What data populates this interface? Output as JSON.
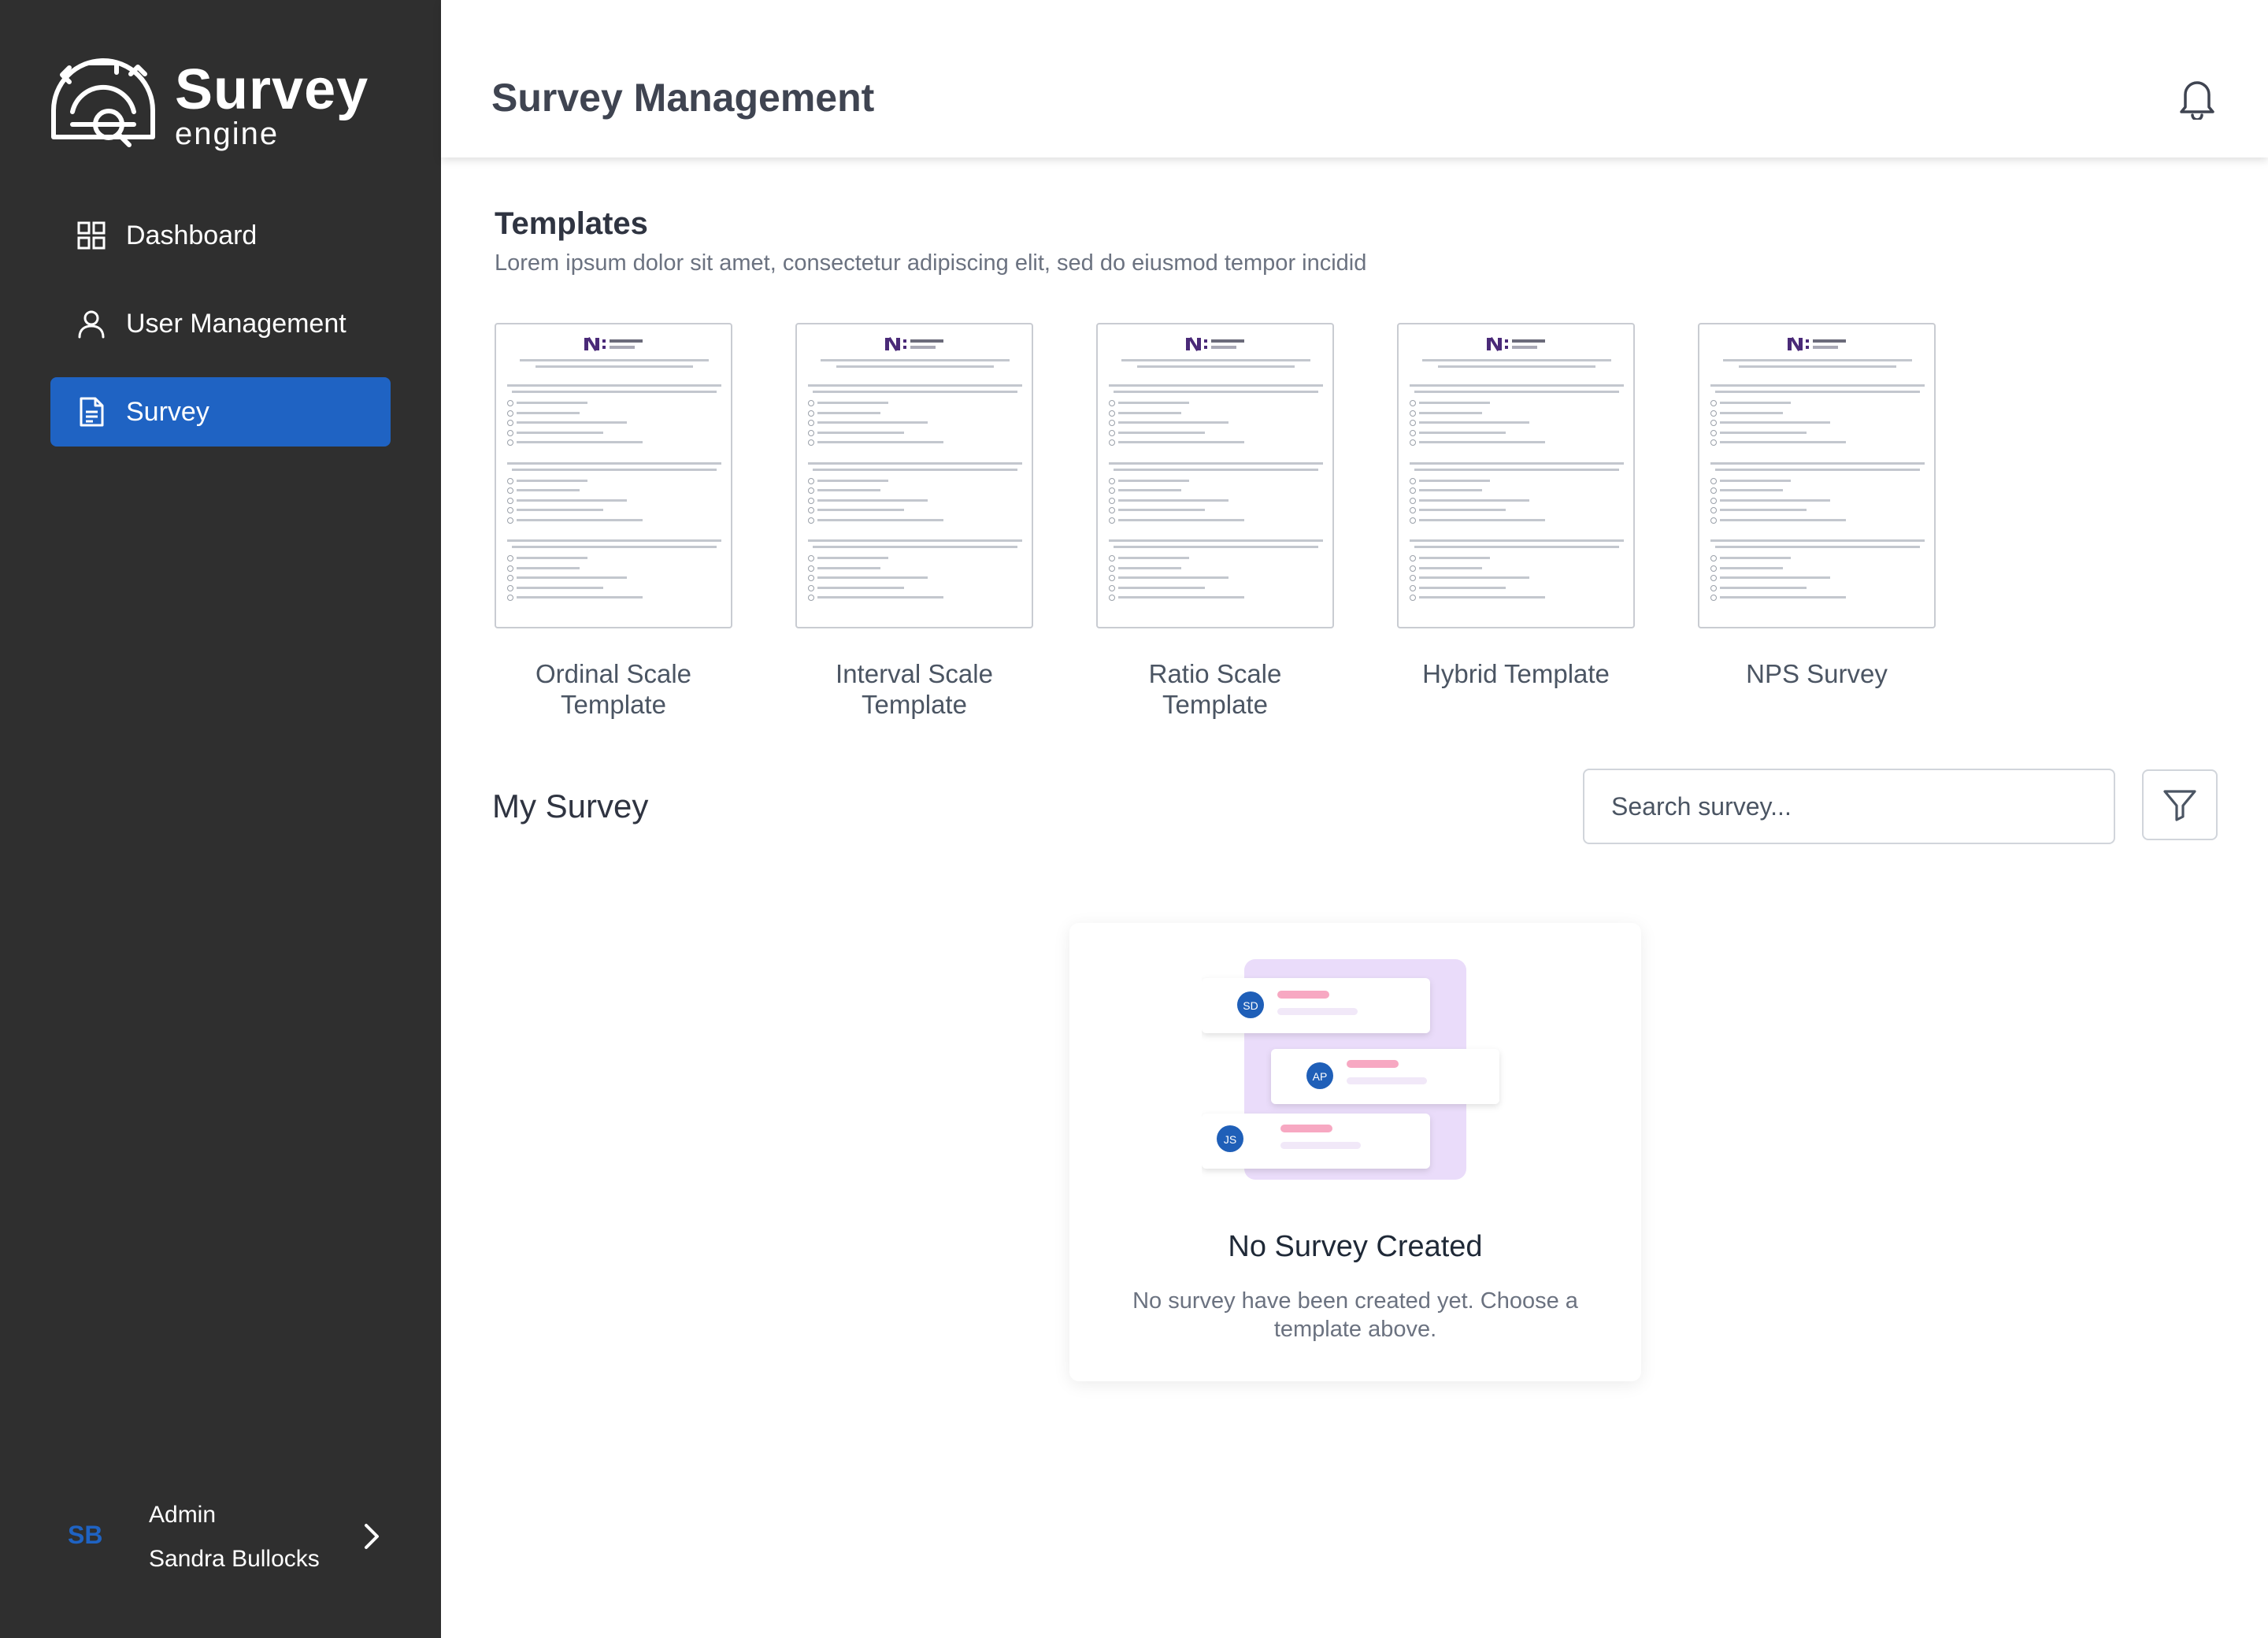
{
  "brand": {
    "title": "Survey",
    "subtitle": "engine"
  },
  "sidebar": {
    "items": [
      {
        "label": "Dashboard",
        "icon": "grid-icon"
      },
      {
        "label": "User Management",
        "icon": "user-icon"
      },
      {
        "label": "Survey",
        "icon": "document-icon",
        "active": true
      }
    ],
    "user": {
      "initials": "SB",
      "role": "Admin",
      "name": "Sandra Bullocks"
    }
  },
  "header": {
    "title": "Survey Management",
    "icon": "bell-icon"
  },
  "templates": {
    "title": "Templates",
    "description": "Lorem ipsum dolor sit amet, consectetur adipiscing elit, sed do eiusmod tempor incidid",
    "items": [
      {
        "line1": "Ordinal Scale",
        "line2": "Template"
      },
      {
        "line1": "Interval Scale",
        "line2": "Template"
      },
      {
        "line1": "Ratio Scale",
        "line2": "Template"
      },
      {
        "line1": "Hybrid Template",
        "line2": ""
      },
      {
        "line1": "NPS Survey",
        "line2": ""
      }
    ]
  },
  "my_survey": {
    "title": "My Survey",
    "search_placeholder": "Search survey...",
    "filter_icon": "filter-icon"
  },
  "empty_state": {
    "title": "No Survey Created",
    "description": "No survey have been created yet. Choose a template above.",
    "avatars": [
      "SD",
      "AP",
      "JS"
    ]
  },
  "colors": {
    "sidebar_bg": "#2f2f2f",
    "accent": "#1f63c3"
  }
}
